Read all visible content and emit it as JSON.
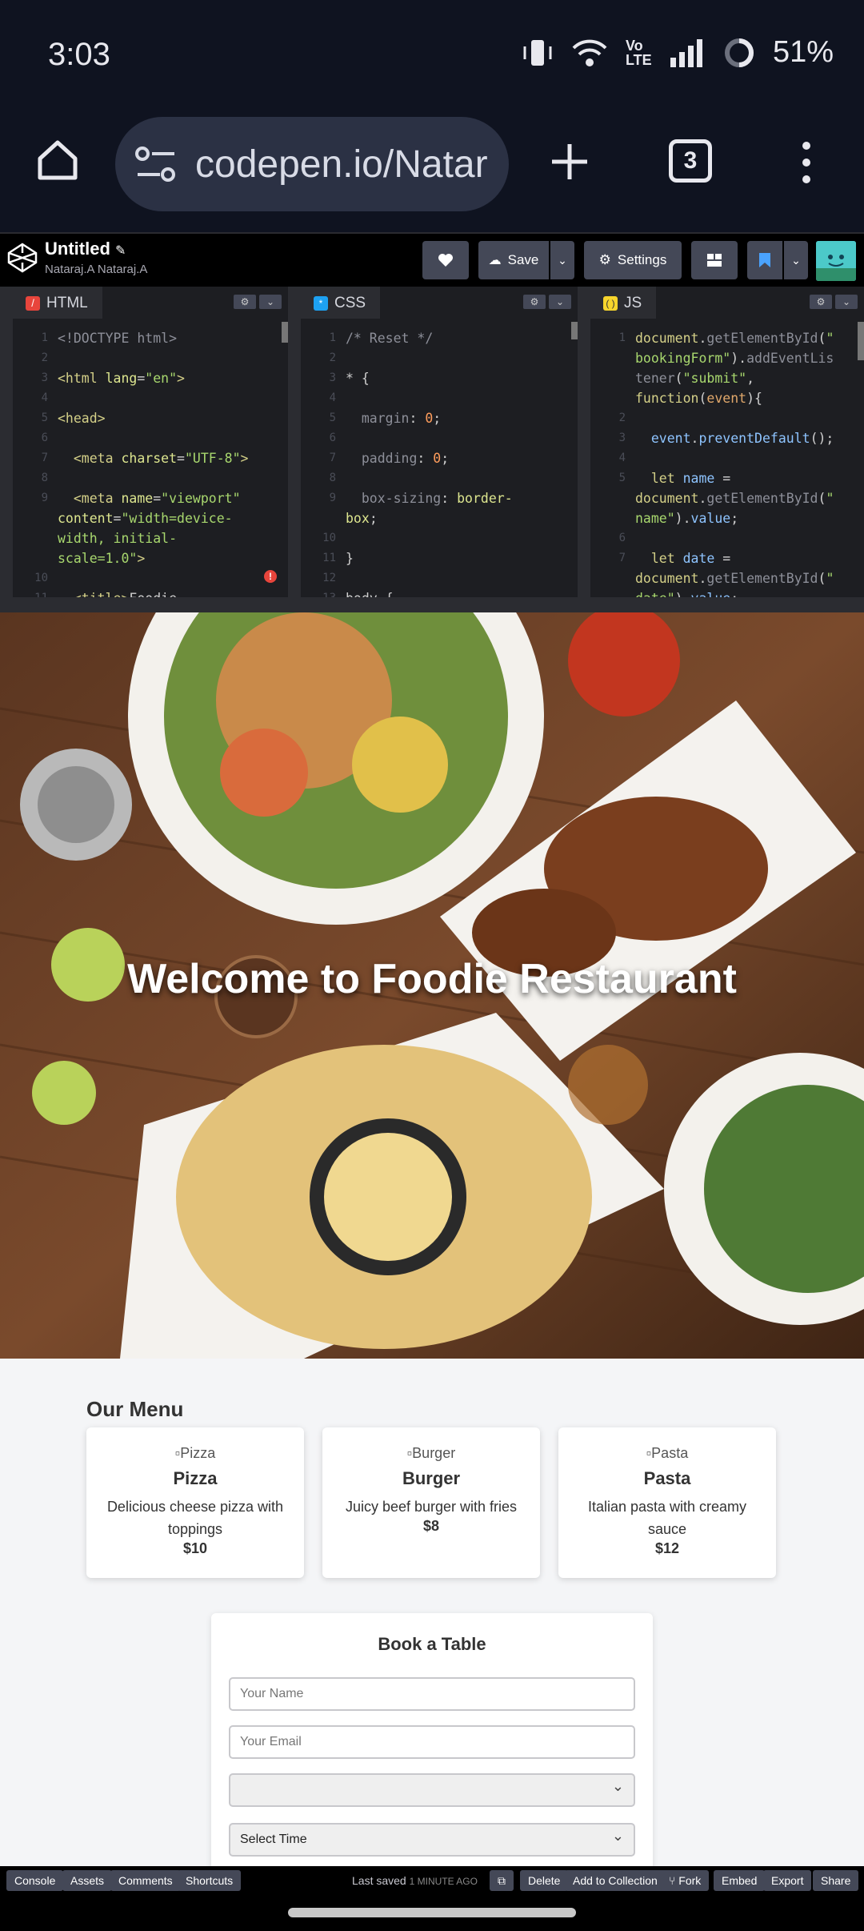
{
  "status": {
    "time": "3:03",
    "network": "Vo LTE",
    "battery": "51%"
  },
  "browser": {
    "url": "codepen.io/Natar",
    "tabs_count": "3"
  },
  "codepen": {
    "title": "Untitled",
    "author": "Nataraj.A Nataraj.A",
    "save_label": "Save",
    "settings_label": "Settings"
  },
  "editors": {
    "html": {
      "label": "HTML"
    },
    "css": {
      "label": "CSS"
    },
    "js": {
      "label": "JS"
    }
  },
  "preview": {
    "hero_title": "Welcome to Foodie Restaurant",
    "menu_heading": "Our Menu",
    "menu": [
      {
        "alt": "Pizza",
        "name": "Pizza",
        "desc1": "Delicious cheese pizza with",
        "desc2": "toppings",
        "price": "$10"
      },
      {
        "alt": "Burger",
        "name": "Burger",
        "desc1": "Juicy beef burger with fries",
        "desc2": "",
        "price": "$8"
      },
      {
        "alt": "Pasta",
        "name": "Pasta",
        "desc1": "Italian pasta with creamy",
        "desc2": "sauce",
        "price": "$12"
      }
    ],
    "booking": {
      "title": "Book a Table",
      "name_placeholder": "Your Name",
      "email_placeholder": "Your Email",
      "select_empty": "",
      "time_label": "Select Time"
    }
  },
  "bottom": {
    "console": "Console",
    "assets": "Assets",
    "comments": "Comments",
    "shortcuts": "Shortcuts",
    "last_saved": "Last saved",
    "last_saved_when": "1 MINUTE AGO",
    "delete": "Delete",
    "add_collection": "Add to Collection",
    "fork": "Fork",
    "embed": "Embed",
    "export": "Export",
    "share": "Share"
  }
}
